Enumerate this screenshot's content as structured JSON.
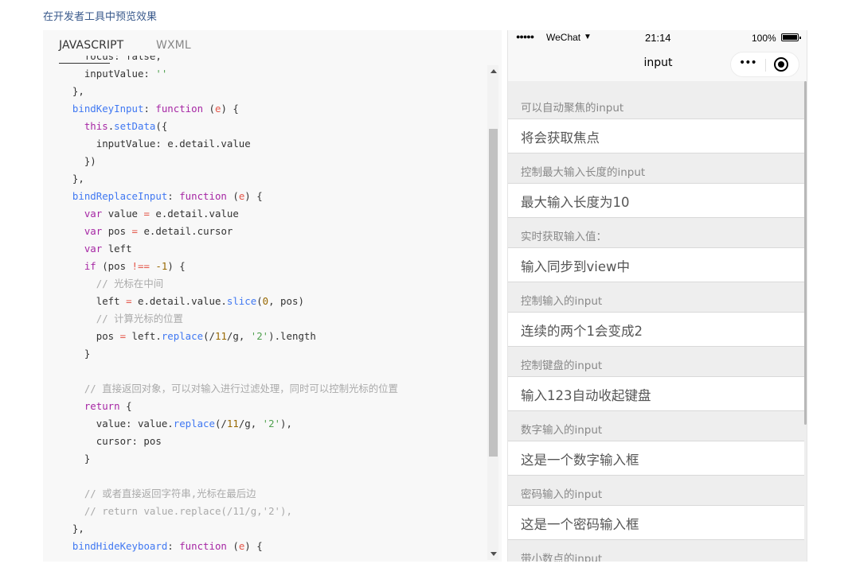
{
  "page": {
    "preview_link": "在开发者工具中预览效果"
  },
  "tabs": [
    "JAVASCRIPT",
    "WXML"
  ],
  "code_lines": [
    "    focus: false,",
    "    inputValue: ''",
    "  },",
    "  bindKeyInput: function (e) {",
    "    this.setData({",
    "      inputValue: e.detail.value",
    "    })",
    "  },",
    "  bindReplaceInput: function (e) {",
    "    var value = e.detail.value",
    "    var pos = e.detail.cursor",
    "    var left",
    "    if (pos !== -1) {",
    "      // 光标在中间",
    "      left = e.detail.value.slice(0, pos)",
    "      // 计算光标的位置",
    "      pos = left.replace(/11/g, '2').length",
    "    }",
    "",
    "    // 直接返回对象，可以对输入进行过滤处理，同时可以控制光标的位置",
    "    return {",
    "      value: value.replace(/11/g, '2'),",
    "      cursor: pos",
    "    }",
    "",
    "    // 或者直接返回字符串,光标在最后边",
    "    // return value.replace(/11/g,'2'),",
    "  },",
    "  bindHideKeyboard: function (e) {"
  ],
  "phone": {
    "status": {
      "signal": "●●●●●",
      "carrier": "WeChat",
      "time": "21:14",
      "battery": "100%"
    },
    "nav_title": "input",
    "capsule_dots": "•••",
    "sections": [
      {
        "label": "可以自动聚焦的input",
        "input": "将会获取焦点"
      },
      {
        "label": "控制最大输入长度的input",
        "input": "最大输入长度为10"
      },
      {
        "label": "实时获取输入值：",
        "input": "输入同步到view中"
      },
      {
        "label": "控制输入的input",
        "input": "连续的两个1会变成2"
      },
      {
        "label": "控制键盘的input",
        "input": "输入123自动收起键盘"
      },
      {
        "label": "数字输入的input",
        "input": "这是一个数字输入框"
      },
      {
        "label": "密码输入的input",
        "input": "这是一个密码输入框"
      },
      {
        "label": "带小数点的input",
        "input": ""
      }
    ]
  },
  "icons": {
    "wifi": "wifi-icon",
    "battery": "battery-icon",
    "more": "more-dots-icon",
    "close": "target-icon"
  }
}
